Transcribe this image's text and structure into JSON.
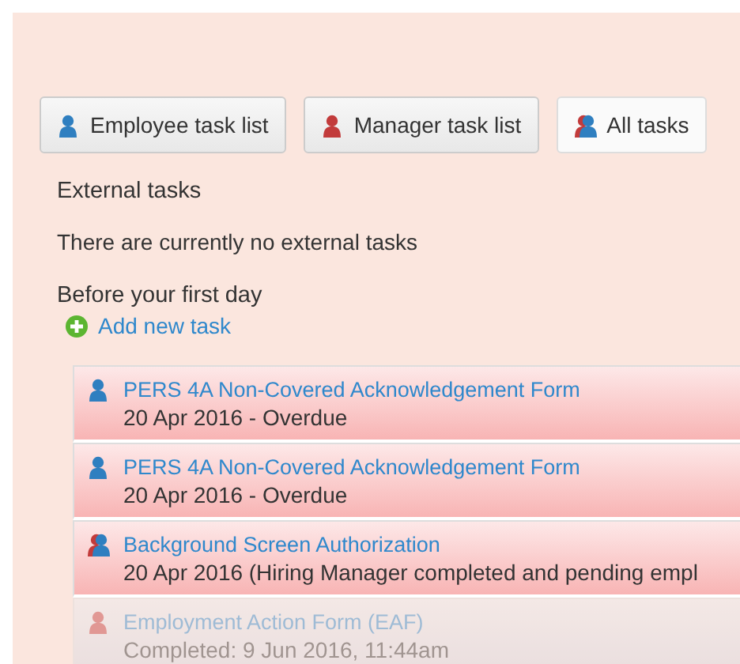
{
  "tabs": [
    {
      "label": "Employee task list",
      "kind": "employee",
      "selected": false
    },
    {
      "label": "Manager task list",
      "kind": "manager",
      "selected": false
    },
    {
      "label": "All tasks",
      "kind": "both",
      "selected": true
    }
  ],
  "external": {
    "heading": "External tasks",
    "message": "There are currently no external tasks"
  },
  "section": {
    "heading": "Before your first day",
    "add_label": "Add new task"
  },
  "tasks": [
    {
      "title": "PERS 4A Non-Covered Acknowledgement Form",
      "detail": "20 Apr 2016 - Overdue",
      "kind": "employee",
      "completed": false
    },
    {
      "title": "PERS 4A Non-Covered Acknowledgement Form",
      "detail": "20 Apr 2016 - Overdue",
      "kind": "employee",
      "completed": false
    },
    {
      "title": "Background Screen Authorization",
      "detail": "20 Apr 2016 (Hiring Manager completed and pending empl",
      "kind": "both",
      "completed": false
    },
    {
      "title": "Employment Action Form (EAF)",
      "detail": "Completed: 9 Jun 2016, 11:44am",
      "kind": "manager",
      "completed": true
    }
  ]
}
